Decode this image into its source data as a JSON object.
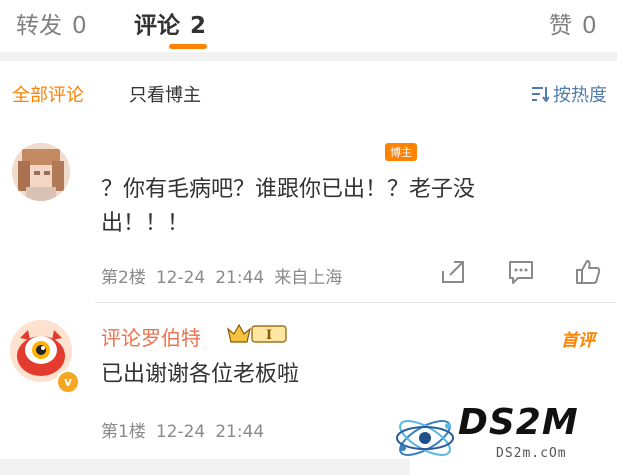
{
  "tabs": [
    {
      "label": "转发",
      "count": "0"
    },
    {
      "label": "评论",
      "count": "2"
    },
    {
      "label": "赞",
      "count": "0"
    }
  ],
  "filters": {
    "all": "全部评论",
    "blogger_only": "只看博主",
    "sort": "按热度"
  },
  "comments": [
    {
      "username": "",
      "tag": "博主",
      "text_line1": "？你有毛病吧？谁跟你已出！？老子没",
      "text_line2": "出！！！",
      "floor": "第2楼",
      "date": "12-24",
      "time": "21:44",
      "source": "来自上海"
    },
    {
      "username": "评论罗伯特",
      "level": "I",
      "badge": "首评",
      "text": "已出谢谢各位老板啦",
      "floor": "第1楼",
      "date": "12-24",
      "time": "21:44"
    }
  ],
  "watermark": {
    "text": "DS2M",
    "sub": "DS2m.cOm"
  },
  "colors": {
    "accent": "#ff8200",
    "link": "#507daf",
    "username": "#eb7350",
    "muted": "#8a8a8a"
  },
  "icons": [
    "sort-icon",
    "share-icon",
    "comment-icon",
    "like-icon",
    "crown-icon",
    "verified-icon"
  ]
}
